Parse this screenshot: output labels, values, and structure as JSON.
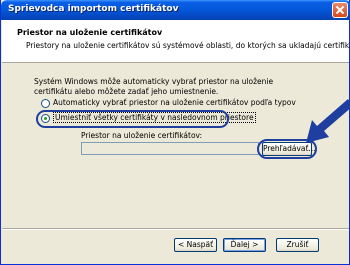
{
  "window": {
    "title": "Sprievodca importom certifikátov"
  },
  "header": {
    "title": "Priestor na uloženie certifikátov",
    "subtitle": "Priestory na uloženie certifikátov sú systémové oblasti, do ktorých sa ukladajú certifikáty."
  },
  "body": {
    "description": "Systém Windows môže automaticky vybrať priestor na uloženie certifikátu alebo môžete zadať jeho umiestnenie.",
    "radio_auto_label": "Automaticky vybrať priestor na uloženie certifikátov podľa typov",
    "radio_manual_label": "Umiestniť všetky certifikáty v nasledovnom priestore",
    "selected_option": "manual",
    "store_label": "Priestor na uloženie certifikátov:",
    "store_value": "",
    "browse_label": "Prehľadávať..."
  },
  "footer": {
    "back_label": "< Naspäť",
    "next_label": "Ďalej >",
    "cancel_label": "Zrušiť"
  },
  "colors": {
    "titlebar": "#0559dc",
    "annotation": "#1f3fa0"
  }
}
